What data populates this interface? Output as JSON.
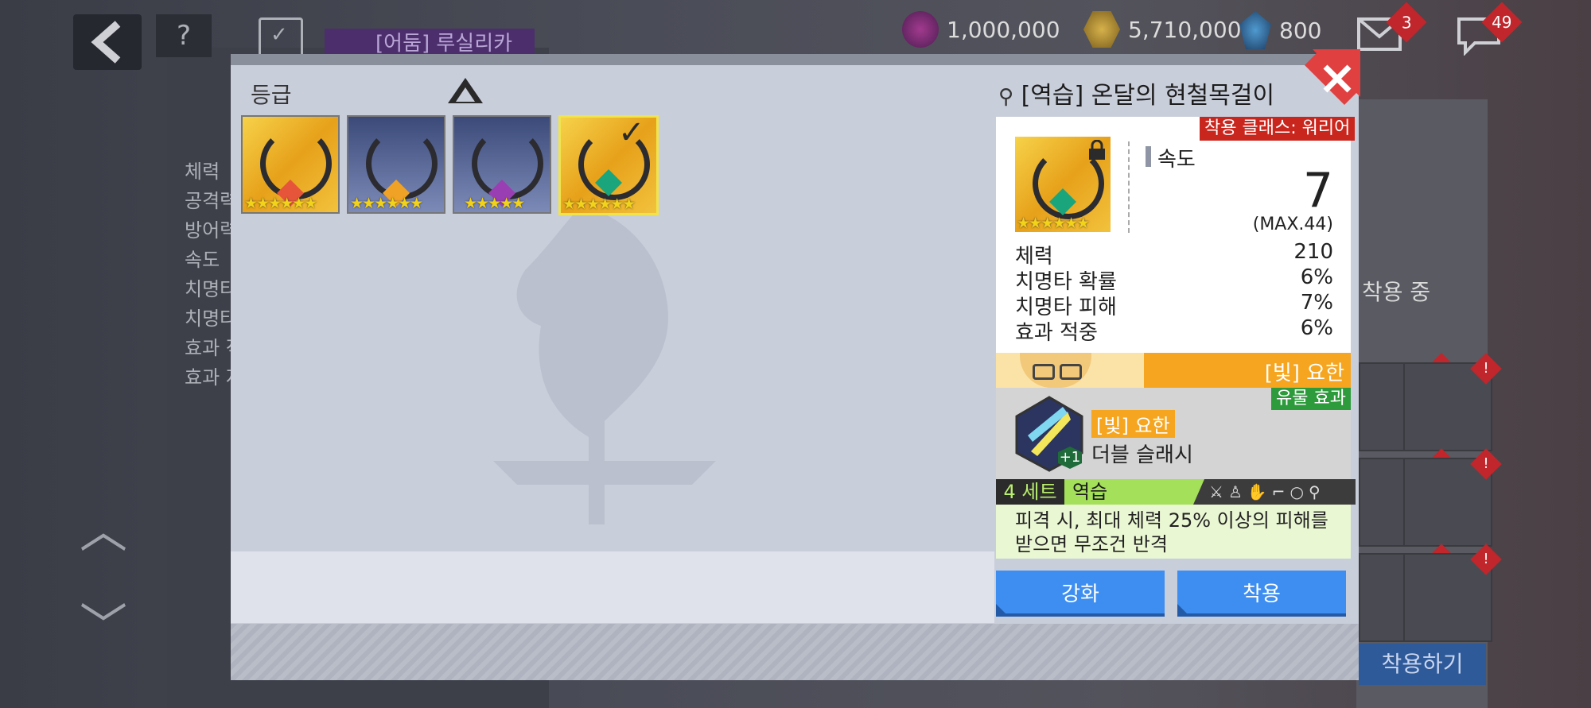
{
  "background": {
    "hero_name": "[어둠] 루실리카",
    "stats": [
      "체력",
      "공격력",
      "방어력",
      "속도",
      "치명타",
      "치명타",
      "효과 적",
      "효과 저"
    ],
    "resources": [
      {
        "icon": "stamina-icon",
        "value": "1,000,000"
      },
      {
        "icon": "gold-coin-icon",
        "value": "5,710,000"
      },
      {
        "icon": "crystal-icon",
        "value": "800"
      }
    ],
    "mail_count": "3",
    "chat_count": "49",
    "equipped_label": "착용 중",
    "equip_all_label": "착용하기"
  },
  "modal": {
    "grade_label": "등급",
    "items": [
      {
        "name": "necklace-1",
        "frame": "gold",
        "stars": "★★★★★★",
        "gem": "#e6553a"
      },
      {
        "name": "necklace-2",
        "frame": "blue",
        "stars": "★★★★★★",
        "gem": "#f0a226"
      },
      {
        "name": "necklace-3",
        "frame": "blue",
        "stars": "★★★★★",
        "gem": "#9a3fb3"
      },
      {
        "name": "necklace-4",
        "frame": "gold",
        "stars": "★★★★★★",
        "gem": "#1aa57d",
        "selected": true
      }
    ],
    "detail": {
      "title": "[역습] 온달의 현철목걸이",
      "class_restriction": "착용 클래스: 워리어",
      "main_stat": {
        "name": "속도",
        "value": "7",
        "max": "(MAX.44)"
      },
      "sub_stats": [
        {
          "name": "체력",
          "value": "210"
        },
        {
          "name": "치명타 확률",
          "value": "6%"
        },
        {
          "name": "치명타 피해",
          "value": "7%"
        },
        {
          "name": "효과 적중",
          "value": "6%"
        }
      ],
      "hero": "[빛] 요한",
      "relic_tag": "유물 효과",
      "skill_hero": "[빛] 요한",
      "skill_name": "더블 슬래시",
      "skill_plus": "+1",
      "set_count": "4 세트",
      "set_name": "역습",
      "set_desc_1": "피격 시, 최대 체력 25% 이상의 피해를",
      "set_desc_2": "받으면 무조건 반격"
    },
    "buttons": {
      "enhance": "강화",
      "equip": "착용"
    }
  },
  "colors": {
    "accent_blue": "#3d8ef0",
    "class_red": "#c9261e",
    "hero_orange": "#f5a51f",
    "set_green": "#a4e05a"
  }
}
